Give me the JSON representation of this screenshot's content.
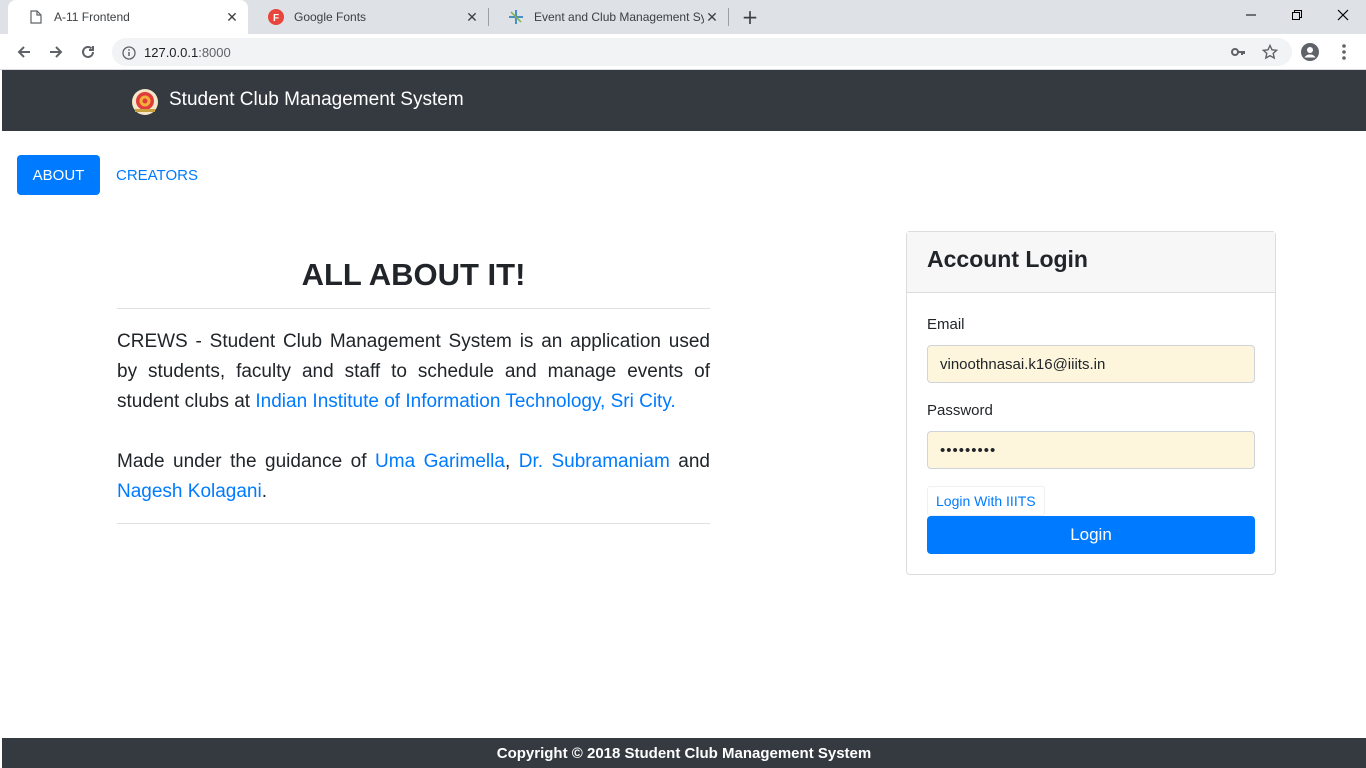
{
  "browser": {
    "tabs": [
      {
        "title": "A-11 Frontend",
        "icon": "page-icon",
        "active": true
      },
      {
        "title": "Google Fonts",
        "icon": "google-fonts-icon",
        "active": false
      },
      {
        "title": "Event and Club Management Sys",
        "icon": "app-icon",
        "active": false
      }
    ],
    "url_host": "127.0.0.1",
    "url_port": ":8000"
  },
  "navbar": {
    "brand": "Student Club Management System",
    "brand_icon": "iiits-logo"
  },
  "nav": {
    "about": "ABOUT",
    "creators": "CREATORS"
  },
  "about": {
    "heading": "ALL ABOUT IT!",
    "p1_text": "CREWS - Student Club Management System is an application used by students, faculty and staff to schedule and manage events of student clubs at ",
    "p1_link": "Indian Institute of Information Technology, Sri City.",
    "p2_text": "Made under the guidance of ",
    "p2_link1": "Uma Garimella",
    "p2_sep": ", ",
    "p2_link2": "Dr. Subramaniam",
    "p2_and": " and ",
    "p2_link3": "Nagesh Kolagani",
    "p2_end": "."
  },
  "login": {
    "title": "Account Login",
    "email_label": "Email",
    "email_value": "vinoothnasai.k16@iiits.in",
    "password_label": "Password",
    "password_value": "•••••••••",
    "iiits_link": "Login With IIITS",
    "submit": "Login"
  },
  "footer": {
    "text": "Copyright © 2018 Student Club Management System"
  },
  "colors": {
    "primary": "#007bff",
    "navbar": "#343a40",
    "autofill": "#fdf6dc"
  }
}
